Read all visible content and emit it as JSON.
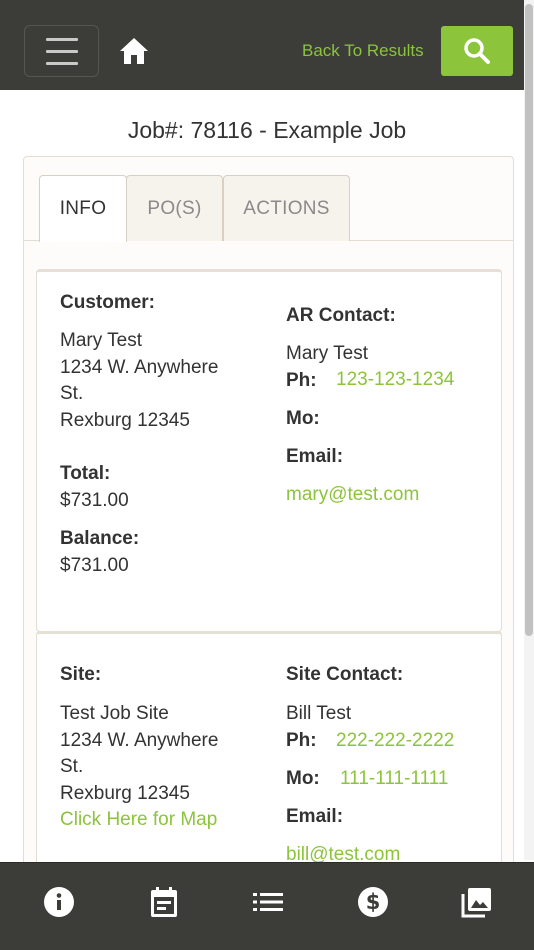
{
  "header": {
    "back_label": "Back To Results",
    "accent": "#8cc43c",
    "bar_color": "#3c3d38",
    "icons": [
      "menu-icon",
      "home-icon",
      "search-icon"
    ]
  },
  "job": {
    "title": "Job#: 78116 - Example Job"
  },
  "tabs": [
    {
      "label": "INFO",
      "active": true
    },
    {
      "label": "PO(S)",
      "active": false
    },
    {
      "label": "ACTIONS",
      "active": false
    }
  ],
  "customer": {
    "label": "Customer:",
    "name": "Mary Test",
    "address1": "1234 W. Anywhere",
    "address2": "St.",
    "city": "Rexburg 12345",
    "total_label": "Total:",
    "total": "$731.00",
    "balance_label": "Balance:",
    "balance": "$731.00"
  },
  "ar_contact": {
    "label": "AR Contact:",
    "name": "Mary Test",
    "ph_label": "Ph:",
    "phone": "123-123-1234",
    "mo_label": "Mo:",
    "mobile": "",
    "email_label": "Email:",
    "email": "mary@test.com"
  },
  "site": {
    "label": "Site:",
    "name": "Test Job Site",
    "address1": "1234 W. Anywhere",
    "address2": "St.",
    "city": "Rexburg 12345",
    "map_link": "Click Here for Map"
  },
  "site_contact": {
    "label": "Site Contact:",
    "name": "Bill Test",
    "ph_label": "Ph:",
    "phone": "222-222-2222",
    "mo_label": "Mo:",
    "mobile": "111-111-1111",
    "email_label": "Email:",
    "email": "bill@test.com"
  },
  "bottom_nav": {
    "icons": [
      "info-icon",
      "calendar-icon",
      "list-icon",
      "dollar-icon",
      "photos-icon"
    ]
  }
}
